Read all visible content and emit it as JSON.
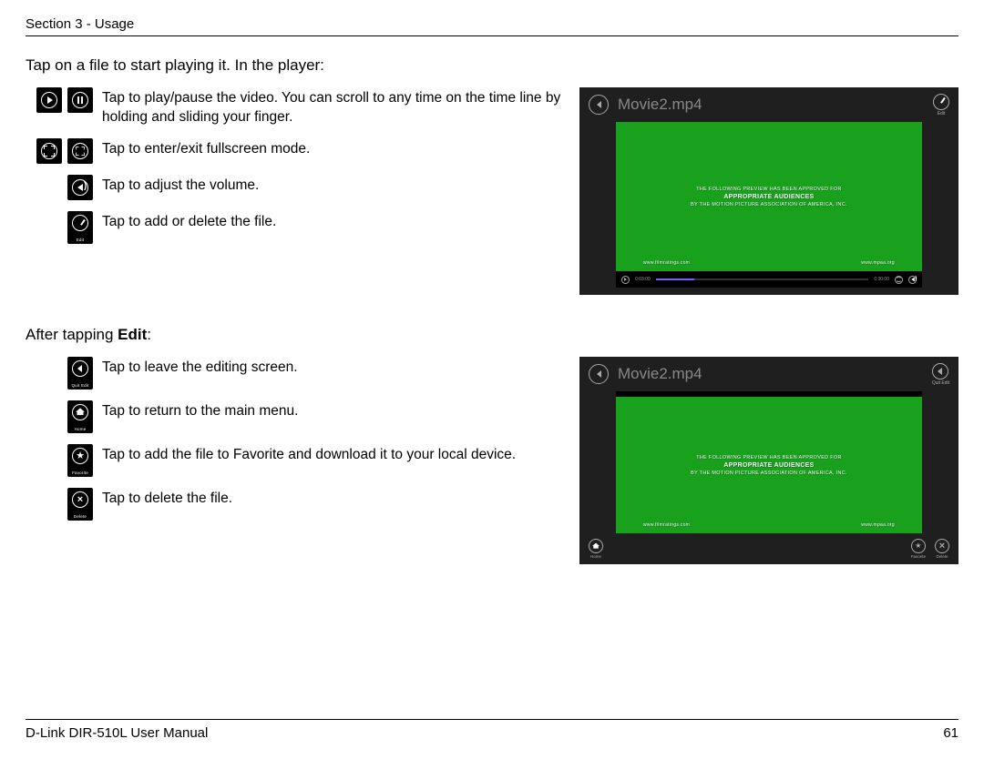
{
  "header": {
    "section": "Section 3 - Usage"
  },
  "sec1": {
    "title": "Tap on a file to start playing it. In the player:",
    "rows": [
      "Tap to play/pause the video. You can scroll to any time on the time line by holding and sliding your finger.",
      "Tap to enter/exit fullscreen mode.",
      "Tap to adjust the volume.",
      "Tap to add or delete the file."
    ]
  },
  "sec2": {
    "title_pre": "After tapping ",
    "title_bold": "Edit",
    "title_post": ":",
    "rows": [
      "Tap to leave the editing screen.",
      "Tap to return to the main menu.",
      "Tap to add the file to Favorite and download it to your local device.",
      "Tap to delete the file."
    ]
  },
  "tile_labels": {
    "edit": "Edit",
    "quit_edit": "Quit Edit",
    "home": "Home",
    "favorite": "Favorite",
    "delete": "Delete"
  },
  "shot": {
    "title": "Movie2.mp4",
    "green_line1": "THE FOLLOWING PREVIEW HAS BEEN APPROVED FOR",
    "green_line2": "APPROPRIATE AUDIENCES",
    "green_line3": "BY THE MOTION PICTURE ASSOCIATION OF AMERICA, INC.",
    "green_bl": "www.filmratings.com",
    "green_br": "www.mpaa.org",
    "time_start": "0:03:00",
    "time_end": "0:30:00",
    "topright_edit": "Edit",
    "topright_quit": "Quit Edit",
    "bb_home": "Home",
    "bb_favorite": "Favorite",
    "bb_delete": "Delete"
  },
  "footer": {
    "left": "D-Link DIR-510L User Manual",
    "right": "61"
  }
}
